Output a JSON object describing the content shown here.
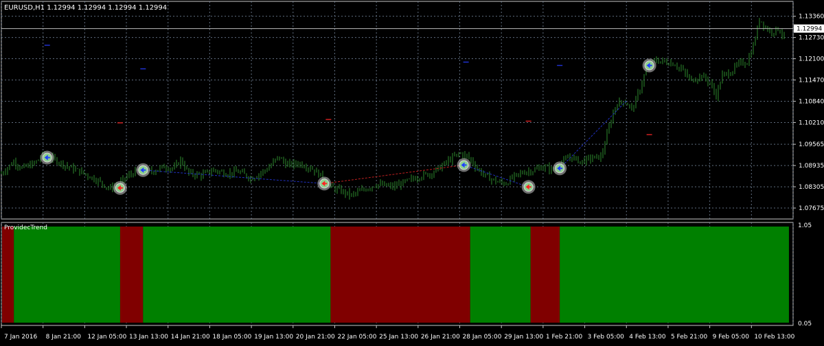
{
  "window": {
    "symbol_line": "EURUSD,H1  1.12994 1.12994 1.12994 1.12994",
    "current_price_label": "1.12994"
  },
  "indicator": {
    "name": "ProvidecTrend",
    "y_max_label": "1.05",
    "y_min_label": "0.05"
  },
  "colors": {
    "background": "#000000",
    "grid": "#7a8aa0",
    "candles": "#2e8b2e",
    "trend_up": "#008000",
    "trend_down": "#800000",
    "buy_arrow": "#1f3fff",
    "sell_arrow": "#ff2020",
    "signal_glow": "#c8c8c8",
    "axis_text": "#ffffff"
  },
  "chart_data": [
    {
      "type": "candlestick",
      "title": "EURUSD,H1",
      "ylim": [
        1.0735,
        1.138
      ],
      "y_ticks": [
        1.1336,
        1.1273,
        1.121,
        1.1147,
        1.1084,
        1.1021,
        1.09565,
        1.08935,
        1.08305,
        1.07675
      ],
      "y_tick_labels": [
        "1.13360",
        "1.12730",
        "1.12100",
        "1.11470",
        "1.10840",
        "1.10210",
        "1.09565",
        "1.08935",
        "1.08305",
        "1.07675"
      ],
      "current_price": 1.12994,
      "x_labels": [
        "7 Jan 2016",
        "8 Jan 21:00",
        "12 Jan 05:00",
        "13 Jan 13:00",
        "14 Jan 21:00",
        "18 Jan 05:00",
        "19 Jan 13:00",
        "20 Jan 21:00",
        "22 Jan 05:00",
        "25 Jan 13:00",
        "26 Jan 21:00",
        "28 Jan 05:00",
        "29 Jan 13:00",
        "1 Feb 21:00",
        "3 Feb 05:00",
        "4 Feb 13:00",
        "5 Feb 21:00",
        "9 Feb 05:00",
        "10 Feb 13:00"
      ],
      "price_path": [
        [
          0,
          1.087
        ],
        [
          0.6,
          1.0905
        ],
        [
          1.0,
          1.0885
        ],
        [
          1.6,
          1.09
        ],
        [
          2.0,
          1.0925
        ],
        [
          2.6,
          1.091
        ],
        [
          3.2,
          1.089
        ],
        [
          3.8,
          1.0875
        ],
        [
          4.6,
          1.085
        ],
        [
          5.2,
          1.0825
        ],
        [
          5.6,
          1.0835
        ],
        [
          6.0,
          1.086
        ],
        [
          6.6,
          1.088
        ],
        [
          7.2,
          1.0875
        ],
        [
          7.8,
          1.089
        ],
        [
          8.3,
          1.0885
        ],
        [
          8.6,
          1.091
        ],
        [
          9.0,
          1.087
        ],
        [
          9.6,
          1.0865
        ],
        [
          10.2,
          1.088
        ],
        [
          10.8,
          1.087
        ],
        [
          11.4,
          1.0875
        ],
        [
          12.0,
          1.0855
        ],
        [
          12.8,
          1.0885
        ],
        [
          13.3,
          1.092
        ],
        [
          13.7,
          1.0895
        ],
        [
          14.3,
          1.09
        ],
        [
          14.9,
          1.0885
        ],
        [
          15.4,
          1.086
        ],
        [
          15.8,
          1.083
        ],
        [
          16.3,
          1.0818
        ],
        [
          16.8,
          1.0805
        ],
        [
          17.4,
          1.0822
        ],
        [
          18.0,
          1.0838
        ],
        [
          18.8,
          1.083
        ],
        [
          19.4,
          1.0845
        ],
        [
          20.0,
          1.086
        ],
        [
          20.6,
          1.087
        ],
        [
          21.0,
          1.0885
        ],
        [
          21.5,
          1.091
        ],
        [
          22.0,
          1.093
        ],
        [
          22.4,
          1.092
        ],
        [
          22.9,
          1.088
        ],
        [
          23.3,
          1.086
        ],
        [
          23.8,
          1.0845
        ],
        [
          24.2,
          1.084
        ],
        [
          24.6,
          1.086
        ],
        [
          25.1,
          1.0875
        ],
        [
          25.6,
          1.088
        ],
        [
          26.0,
          1.089
        ],
        [
          26.5,
          1.088
        ],
        [
          26.9,
          1.09
        ],
        [
          27.3,
          1.092
        ],
        [
          27.8,
          1.0905
        ],
        [
          28.3,
          1.0915
        ],
        [
          28.8,
          1.092
        ],
        [
          29.2,
          1.1015
        ],
        [
          29.5,
          1.1075
        ],
        [
          29.9,
          1.1085
        ],
        [
          30.3,
          1.106
        ],
        [
          30.7,
          1.113
        ],
        [
          31.0,
          1.119
        ],
        [
          31.4,
          1.1205
        ],
        [
          31.9,
          1.12
        ],
        [
          32.3,
          1.1195
        ],
        [
          32.7,
          1.1175
        ],
        [
          33.1,
          1.1145
        ],
        [
          33.6,
          1.116
        ],
        [
          34.0,
          1.114
        ],
        [
          34.3,
          1.11
        ],
        [
          34.6,
          1.116
        ],
        [
          35.0,
          1.117
        ],
        [
          35.4,
          1.1195
        ],
        [
          35.8,
          1.12
        ],
        [
          36.1,
          1.125
        ],
        [
          36.4,
          1.133
        ],
        [
          36.7,
          1.13
        ],
        [
          37.0,
          1.129
        ],
        [
          37.3,
          1.13
        ],
        [
          37.6,
          1.127
        ]
      ],
      "signals": [
        {
          "x": 2.2,
          "price": 1.0917,
          "direction": "buy"
        },
        {
          "x": 5.7,
          "price": 1.0827,
          "direction": "sell"
        },
        {
          "x": 6.8,
          "price": 1.088,
          "direction": "buy"
        },
        {
          "x": 15.5,
          "price": 1.084,
          "direction": "sell"
        },
        {
          "x": 22.2,
          "price": 1.0895,
          "direction": "buy"
        },
        {
          "x": 25.3,
          "price": 1.083,
          "direction": "sell"
        },
        {
          "x": 26.8,
          "price": 1.0885,
          "direction": "buy"
        },
        {
          "x": 31.1,
          "price": 1.119,
          "direction": "buy"
        }
      ],
      "connector_lines": [
        {
          "from": [
            6.8,
            1.088
          ],
          "to": [
            15.5,
            1.084
          ],
          "color": "blue"
        },
        {
          "from": [
            15.5,
            1.084
          ],
          "to": [
            22.2,
            1.0895
          ],
          "color": "red"
        },
        {
          "from": [
            22.2,
            1.0895
          ],
          "to": [
            25.3,
            1.083
          ],
          "color": "blue"
        },
        {
          "from": [
            26.8,
            1.0885
          ],
          "to": [
            30.0,
            1.1085
          ],
          "color": "blue"
        }
      ],
      "level_dashes": [
        {
          "x": 2.2,
          "price": 1.125,
          "color": "blue"
        },
        {
          "x": 6.8,
          "price": 1.118,
          "color": "blue"
        },
        {
          "x": 22.3,
          "price": 1.12,
          "color": "blue"
        },
        {
          "x": 26.8,
          "price": 1.119,
          "color": "blue"
        },
        {
          "x": 5.7,
          "price": 1.102,
          "color": "red"
        },
        {
          "x": 15.7,
          "price": 1.103,
          "color": "red"
        },
        {
          "x": 25.3,
          "price": 1.1025,
          "color": "red"
        },
        {
          "x": 31.1,
          "price": 1.0985,
          "color": "red"
        }
      ]
    },
    {
      "type": "histogram",
      "title": "ProvidecTrend",
      "ylim": [
        0.05,
        1.05
      ],
      "segments": [
        {
          "start": 0.0,
          "end": 0.6,
          "state": "down"
        },
        {
          "start": 0.6,
          "end": 5.7,
          "state": "up"
        },
        {
          "start": 5.7,
          "end": 6.8,
          "state": "down"
        },
        {
          "start": 6.8,
          "end": 15.8,
          "state": "up"
        },
        {
          "start": 15.8,
          "end": 22.5,
          "state": "down"
        },
        {
          "start": 22.5,
          "end": 25.4,
          "state": "up"
        },
        {
          "start": 25.4,
          "end": 26.8,
          "state": "down"
        },
        {
          "start": 26.8,
          "end": 37.8,
          "state": "up"
        }
      ]
    }
  ]
}
